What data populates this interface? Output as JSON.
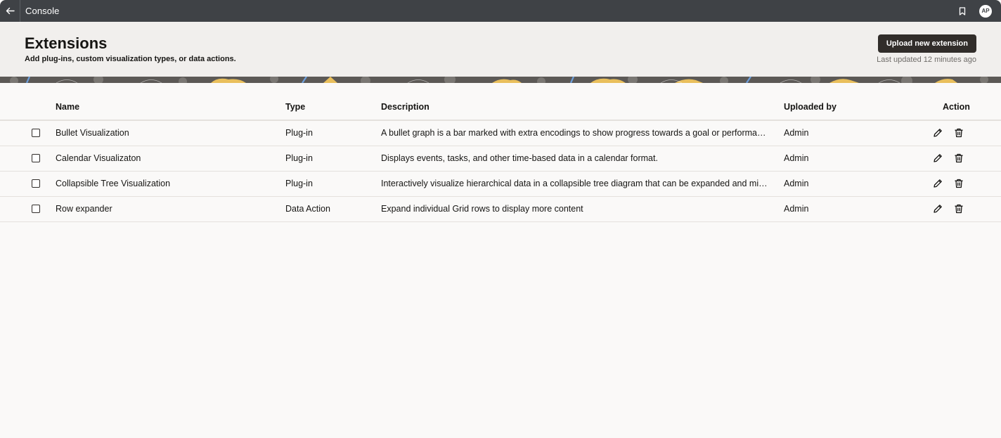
{
  "topbar": {
    "title": "Console",
    "back_icon": "arrow-left-icon",
    "bookmark_icon": "bookmark-icon",
    "avatar_initials": "AP"
  },
  "header": {
    "title": "Extensions",
    "subtitle": "Add plug-ins, custom visualization types, or data actions.",
    "upload_button_label": "Upload new extension",
    "last_updated": "Last updated 12 minutes ago"
  },
  "table": {
    "columns": {
      "name": "Name",
      "type": "Type",
      "description": "Description",
      "uploaded_by": "Uploaded by",
      "action": "Action"
    },
    "rows": [
      {
        "name": "Bullet Visualization",
        "type": "Plug-in",
        "description": "A bullet graph is a bar marked with extra encodings to show progress towards a goal or performance against a reference line",
        "uploaded_by": "Admin"
      },
      {
        "name": "Calendar Visualizaton",
        "type": "Plug-in",
        "description": "Displays events, tasks, and other time-based data in a calendar format.",
        "uploaded_by": "Admin"
      },
      {
        "name": "Collapsible Tree Visualization",
        "type": "Plug-in",
        "description": "Interactively visualize hierarchical data in a collapsible tree diagram that can be expanded and minimized",
        "uploaded_by": "Admin"
      },
      {
        "name": "Row expander",
        "type": "Data Action",
        "description": "Expand individual Grid rows to display more content",
        "uploaded_by": "Admin"
      }
    ],
    "row_actions": [
      "edit-icon",
      "delete-icon"
    ]
  },
  "colors": {
    "topbar": "#3f4246",
    "header_bg": "#f1efed",
    "page_bg": "#faf9f8",
    "primary_button": "#312d2a",
    "banner_yellow": "#e9bf5c",
    "banner_blue": "#6d9fdc",
    "banner_gray": "#8a8784"
  }
}
